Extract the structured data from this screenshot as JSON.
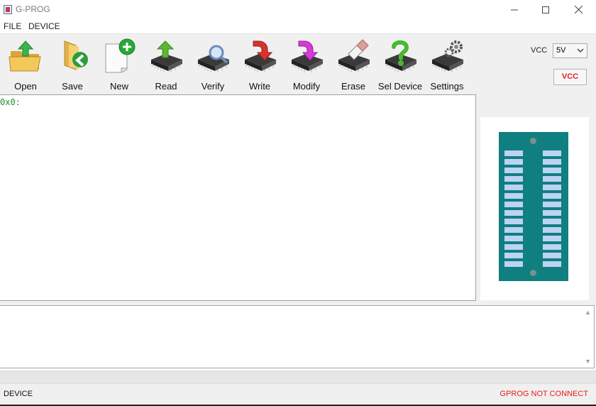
{
  "window": {
    "title": "G-PROG",
    "icon": "app-icon",
    "controls": [
      "minimize-icon",
      "maximize-icon",
      "close-icon"
    ]
  },
  "menubar": {
    "items": [
      {
        "label": "FILE"
      },
      {
        "label": "DEVICE"
      }
    ]
  },
  "toolbar": {
    "tools": [
      {
        "label": "Open",
        "icon": "open-folder-icon",
        "accent": "#3bb54a"
      },
      {
        "label": "Save",
        "icon": "save-folder-icon",
        "accent": "#2e9b3a"
      },
      {
        "label": "New",
        "icon": "new-document-icon",
        "accent": "#29a83a"
      },
      {
        "label": "Read",
        "icon": "read-chip-icon",
        "accent": "#5cb832"
      },
      {
        "label": "Verify",
        "icon": "verify-chip-icon",
        "accent": "#6b8db7"
      },
      {
        "label": "Write",
        "icon": "write-chip-icon",
        "accent": "#d8332f"
      },
      {
        "label": "Modify",
        "icon": "modify-chip-icon",
        "accent": "#d43bd9"
      },
      {
        "label": "Erase",
        "icon": "erase-chip-icon",
        "accent": "#d9a09a"
      },
      {
        "label": "Sel Device",
        "icon": "select-device-icon",
        "accent": "#4bb82f"
      },
      {
        "label": "Settings",
        "icon": "settings-chip-icon",
        "accent": "#555555"
      }
    ],
    "vcc": {
      "label": "VCC",
      "selected": "5V",
      "button_label": "VCC",
      "button_color": "#e12424"
    }
  },
  "hex_view": {
    "lines": [
      "0x0:"
    ],
    "text_color": "#2a8a2a"
  },
  "chip_preview": {
    "body_color": "#0f7f7f",
    "pin_color": "#bcd3f2",
    "pins_per_side": 14
  },
  "log": {
    "lines": []
  },
  "statusbar": {
    "left": "DEVICE",
    "right": "GPROG NOT CONNECT",
    "right_color": "#e81b1b"
  }
}
